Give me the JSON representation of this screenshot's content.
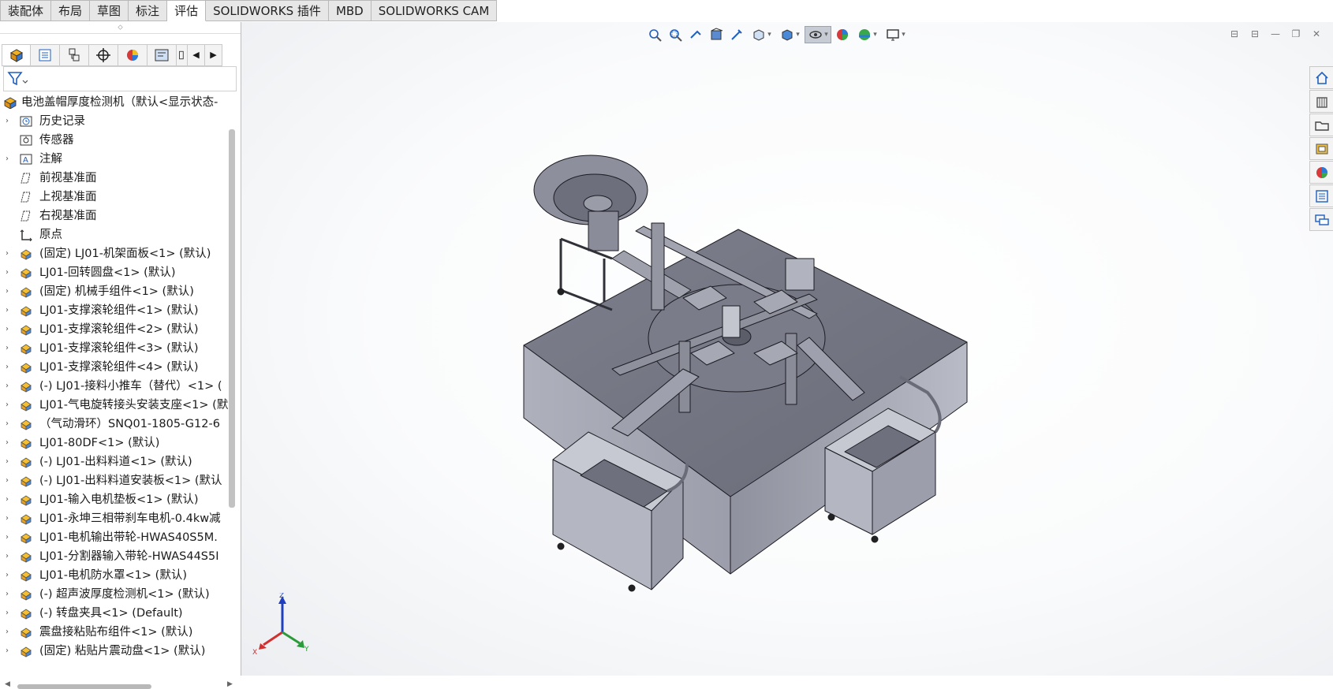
{
  "command_tabs": [
    {
      "label": "装配体",
      "active": false
    },
    {
      "label": "布局",
      "active": false
    },
    {
      "label": "草图",
      "active": false
    },
    {
      "label": "标注",
      "active": false
    },
    {
      "label": "评估",
      "active": true
    },
    {
      "label": "SOLIDWORKS 插件",
      "active": false
    },
    {
      "label": "MBD",
      "active": false
    },
    {
      "label": "SOLIDWORKS CAM",
      "active": false
    }
  ],
  "panel_tabs": [
    "feature-manager-icon",
    "property-manager-icon",
    "configuration-manager-icon",
    "dimxpert-icon",
    "display-manager-icon",
    "cam-feature-tree-icon",
    "cam-operation-tree-icon"
  ],
  "tree": {
    "root": "电池盖帽厚度检测机（默认<显示状态-",
    "items": [
      {
        "label": "历史记录",
        "icon": "history-icon",
        "expandable": true
      },
      {
        "label": "传感器",
        "icon": "sensor-icon",
        "expandable": false
      },
      {
        "label": "注解",
        "icon": "annotation-icon",
        "expandable": true
      },
      {
        "label": "前视基准面",
        "icon": "plane-icon",
        "expandable": false
      },
      {
        "label": "上视基准面",
        "icon": "plane-icon",
        "expandable": false
      },
      {
        "label": "右视基准面",
        "icon": "plane-icon",
        "expandable": false
      },
      {
        "label": "原点",
        "icon": "origin-icon",
        "expandable": false
      },
      {
        "label": "(固定) LJ01-机架面板<1> (默认)",
        "icon": "subassembly-icon",
        "expandable": true
      },
      {
        "label": "LJ01-回转圆盘<1> (默认)",
        "icon": "subassembly-icon",
        "expandable": true
      },
      {
        "label": "(固定) 机械手组件<1> (默认)",
        "icon": "subassembly-icon",
        "expandable": true
      },
      {
        "label": "LJ01-支撑滚轮组件<1> (默认)",
        "icon": "subassembly-icon",
        "expandable": true
      },
      {
        "label": "LJ01-支撑滚轮组件<2> (默认)",
        "icon": "subassembly-icon",
        "expandable": true
      },
      {
        "label": "LJ01-支撑滚轮组件<3> (默认)",
        "icon": "subassembly-icon",
        "expandable": true
      },
      {
        "label": "LJ01-支撑滚轮组件<4> (默认)",
        "icon": "subassembly-icon",
        "expandable": true
      },
      {
        "label": "(-) LJ01-接料小推车（替代）<1> (",
        "icon": "subassembly-icon",
        "expandable": true
      },
      {
        "label": "LJ01-气电旋转接头安装支座<1> (默",
        "icon": "subassembly-icon",
        "expandable": true
      },
      {
        "label": "（气动滑环）SNQ01-1805-G12-6",
        "icon": "subassembly-icon",
        "expandable": true
      },
      {
        "label": "LJ01-80DF<1> (默认)",
        "icon": "subassembly-icon",
        "expandable": true
      },
      {
        "label": "(-) LJ01-出料料道<1> (默认)",
        "icon": "subassembly-icon",
        "expandable": true
      },
      {
        "label": "(-) LJ01-出料料道安装板<1> (默认",
        "icon": "subassembly-icon",
        "expandable": true
      },
      {
        "label": "LJ01-输入电机垫板<1> (默认)",
        "icon": "subassembly-icon",
        "expandable": true
      },
      {
        "label": "LJ01-永坤三相带刹车电机-0.4kw减",
        "icon": "subassembly-icon",
        "expandable": true
      },
      {
        "label": "LJ01-电机输出带轮-HWAS40S5M.",
        "icon": "subassembly-icon",
        "expandable": true
      },
      {
        "label": "LJ01-分割器输入带轮-HWAS44S5I",
        "icon": "subassembly-icon",
        "expandable": true
      },
      {
        "label": "LJ01-电机防水罩<1> (默认)",
        "icon": "subassembly-icon",
        "expandable": true
      },
      {
        "label": "(-) 超声波厚度检测机<1> (默认)",
        "icon": "subassembly-icon",
        "expandable": true
      },
      {
        "label": "(-) 转盘夹具<1> (Default)",
        "icon": "subassembly-icon",
        "expandable": true
      },
      {
        "label": "震盘接粘贴布组件<1> (默认)",
        "icon": "subassembly-icon",
        "expandable": true
      },
      {
        "label": "(固定) 粘贴片震动盘<1> (默认)",
        "icon": "subassembly-icon",
        "expandable": true
      }
    ]
  },
  "heads_up": [
    {
      "name": "zoom-to-fit-icon",
      "dd": false
    },
    {
      "name": "zoom-to-area-icon",
      "dd": false
    },
    {
      "name": "previous-view-icon",
      "dd": false
    },
    {
      "name": "section-view-icon",
      "dd": false
    },
    {
      "name": "dynamic-annotation-icon",
      "dd": false
    },
    {
      "name": "view-orientation-icon",
      "dd": true
    },
    {
      "name": "display-style-icon",
      "dd": true
    },
    {
      "name": "hide-show-items-icon",
      "dd": true,
      "selected": true
    },
    {
      "name": "edit-appearance-icon",
      "dd": false
    },
    {
      "name": "apply-scene-icon",
      "dd": true
    },
    {
      "name": "view-settings-icon",
      "dd": true
    }
  ],
  "triad": {
    "x": "X",
    "y": "Y",
    "z": "Z"
  },
  "colors": {
    "model_face": "#8a8c9a",
    "model_dark": "#5f6170",
    "model_light": "#aeb0bc",
    "edge": "#1c1c22",
    "accent": "#1f6fd1"
  }
}
